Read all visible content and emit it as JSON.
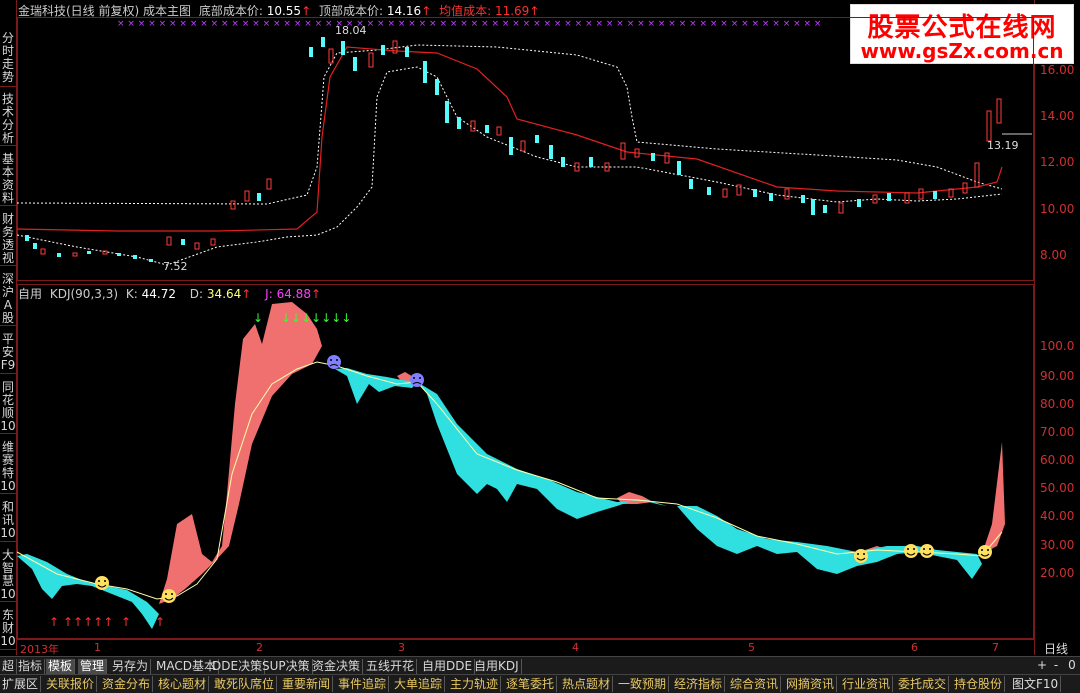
{
  "title_bar": {
    "stock": "金瑞科技(日线 前复权) 成本主图",
    "bottom_cost_label": "底部成本价:",
    "bottom_cost_value": "10.55",
    "top_cost_label": "顶部成本价:",
    "top_cost_value": "14.16",
    "avg_cost_label": "均值成本:",
    "avg_cost_value": "11.69",
    "arrow": "↑"
  },
  "watermark": {
    "title": "股票公式在线网",
    "url": "www.gsZx.com.cn"
  },
  "left_tabs": [
    {
      "label": "分时走势"
    },
    {
      "label": "技术分析"
    },
    {
      "label": "基本资料"
    },
    {
      "label": "财务透视"
    },
    {
      "label": "深沪A股"
    },
    {
      "label": "平安F9"
    },
    {
      "label": "同花顺10"
    },
    {
      "label": "维赛特10"
    },
    {
      "label": "和讯10"
    },
    {
      "label": "大智慧10"
    },
    {
      "label": "东财10"
    }
  ],
  "price_axis": [
    "16.00",
    "14.00",
    "12.00",
    "10.00",
    "8.00"
  ],
  "price_annotations": {
    "high": "18.04",
    "low": "7.52",
    "last": "13.19"
  },
  "kdj_bar": {
    "name": "自用",
    "indicator": "KDJ(90,3,3)",
    "k_label": "K:",
    "k_value": "44.72",
    "d_label": "D:",
    "d_value": "34.64",
    "j_label": "J:",
    "j_value": "64.88",
    "arrow": "↑"
  },
  "kdj_axis": [
    "100.0",
    "90.00",
    "80.00",
    "70.00",
    "60.00",
    "50.00",
    "40.00",
    "30.00",
    "20.00"
  ],
  "time_axis": [
    "2013年",
    "1",
    "2",
    "3",
    "4",
    "5",
    "6",
    "7"
  ],
  "period_label": "日线",
  "tabs": [
    {
      "label": "超"
    },
    {
      "label": "指标"
    },
    {
      "label": "模板"
    },
    {
      "label": "管理"
    },
    {
      "label": "另存为"
    },
    {
      "label": "MACD基本"
    },
    {
      "label": "DDE决策"
    },
    {
      "label": "SUP决策"
    },
    {
      "label": "资金决策"
    },
    {
      "label": "五线开花"
    },
    {
      "label": "自用DDE"
    },
    {
      "label": "自用KDJ"
    }
  ],
  "func_tabs": [
    {
      "label": "扩展区"
    },
    {
      "label": "关联报价"
    },
    {
      "label": "资金分布"
    },
    {
      "label": "核心题材"
    },
    {
      "label": "敢死队席位"
    },
    {
      "label": "重要新闻"
    },
    {
      "label": "事件追踪"
    },
    {
      "label": "大单追踪"
    },
    {
      "label": "主力轨迹"
    },
    {
      "label": "逐笔委托"
    },
    {
      "label": "热点题材"
    },
    {
      "label": "一致预期"
    },
    {
      "label": "经济指标"
    },
    {
      "label": "综合资讯"
    },
    {
      "label": "网摘资讯"
    },
    {
      "label": "行业资讯"
    },
    {
      "label": "委托成交"
    },
    {
      "label": "持仓股份"
    },
    {
      "label": "图文F10"
    }
  ],
  "controls": {
    "plus": "+",
    "minus": "-",
    "zero": "0",
    "up": "↑"
  },
  "colors": {
    "frame": "#7a1a1a",
    "red_candle": "#ff3c3c",
    "cyan_candle": "#54fcfc",
    "cost_red": "#e02020",
    "cost_white": "#ffffff",
    "kdj_pink": "#f07070",
    "kdj_cyan": "#30e0e0",
    "d_line": "#ffffaa",
    "j_text": "#ff40ff"
  }
}
